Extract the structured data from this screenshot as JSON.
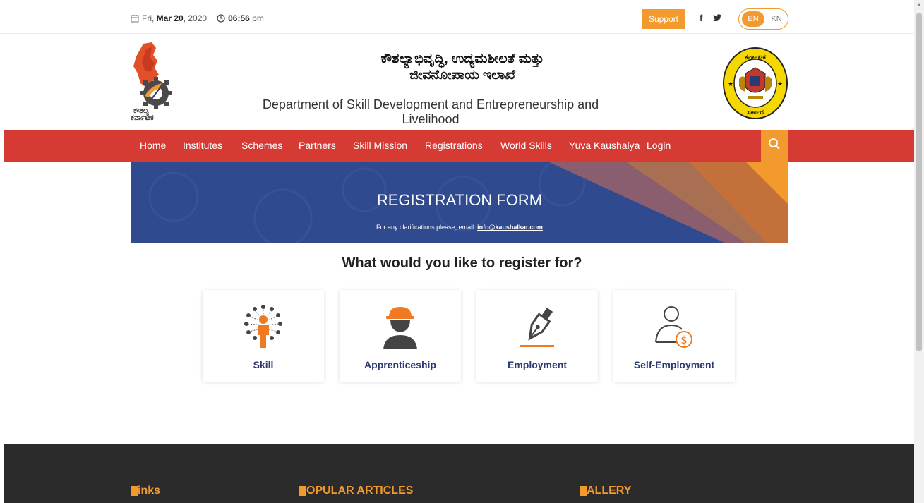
{
  "topbar": {
    "date_day": "Fri,",
    "date_month": "Mar",
    "date_num": "20",
    "date_year": ", 2020",
    "time": "06:56",
    "ampm": "pm",
    "support_label": "Support",
    "facebook": "f",
    "twitter": "🐦",
    "lang_en": "EN",
    "lang_kn": "KN"
  },
  "header": {
    "title_kn_line1": "ಕೌಶಲ್ಯಾಭಿವೃದ್ಧಿ, ಉದ್ಯಮಶೀಲತೆ ಮತ್ತು",
    "title_kn_line2": "ಜೀವನೋಪಾಯ ಇಲಾಖೆ",
    "title_en": "Department of Skill Development and Entrepreneurship and Livelihood",
    "logo_text": "ಕೌಶಲ್ಯ ಕರ್ನಾಟಕ",
    "seal_top_text": "ಕರ್ನಾಟಕ",
    "seal_bottom_text": "ಸರ್ಕಾರ"
  },
  "nav": {
    "items": [
      "Home",
      "Institutes",
      "Schemes",
      "Partners",
      "Skill Mission",
      "Registrations",
      "World Skills",
      "Yuva Kaushalya",
      "Login"
    ]
  },
  "banner": {
    "title": "REGISTRATION FORM",
    "subtitle": "For any clarifications please, email:",
    "email": "info@kaushalkar.com"
  },
  "main": {
    "question": "What would you like to register for?",
    "cards": [
      {
        "label": "Skill",
        "icon": "skill-network-icon"
      },
      {
        "label": "Apprenticeship",
        "icon": "hardhat-worker-icon"
      },
      {
        "label": "Employment",
        "icon": "pen-nib-icon"
      },
      {
        "label": "Self-Employment",
        "icon": "person-dollar-icon"
      }
    ]
  },
  "footer": {
    "links": "inks",
    "popular": "OPULAR ARTICLES",
    "gallery": "ALLERY"
  },
  "colors": {
    "accent_orange": "#f29a2e",
    "nav_red": "#d63b33",
    "banner_blue": "#2f4a8e",
    "card_label": "#2b3a73",
    "footer_bg": "#2b2b2b"
  }
}
